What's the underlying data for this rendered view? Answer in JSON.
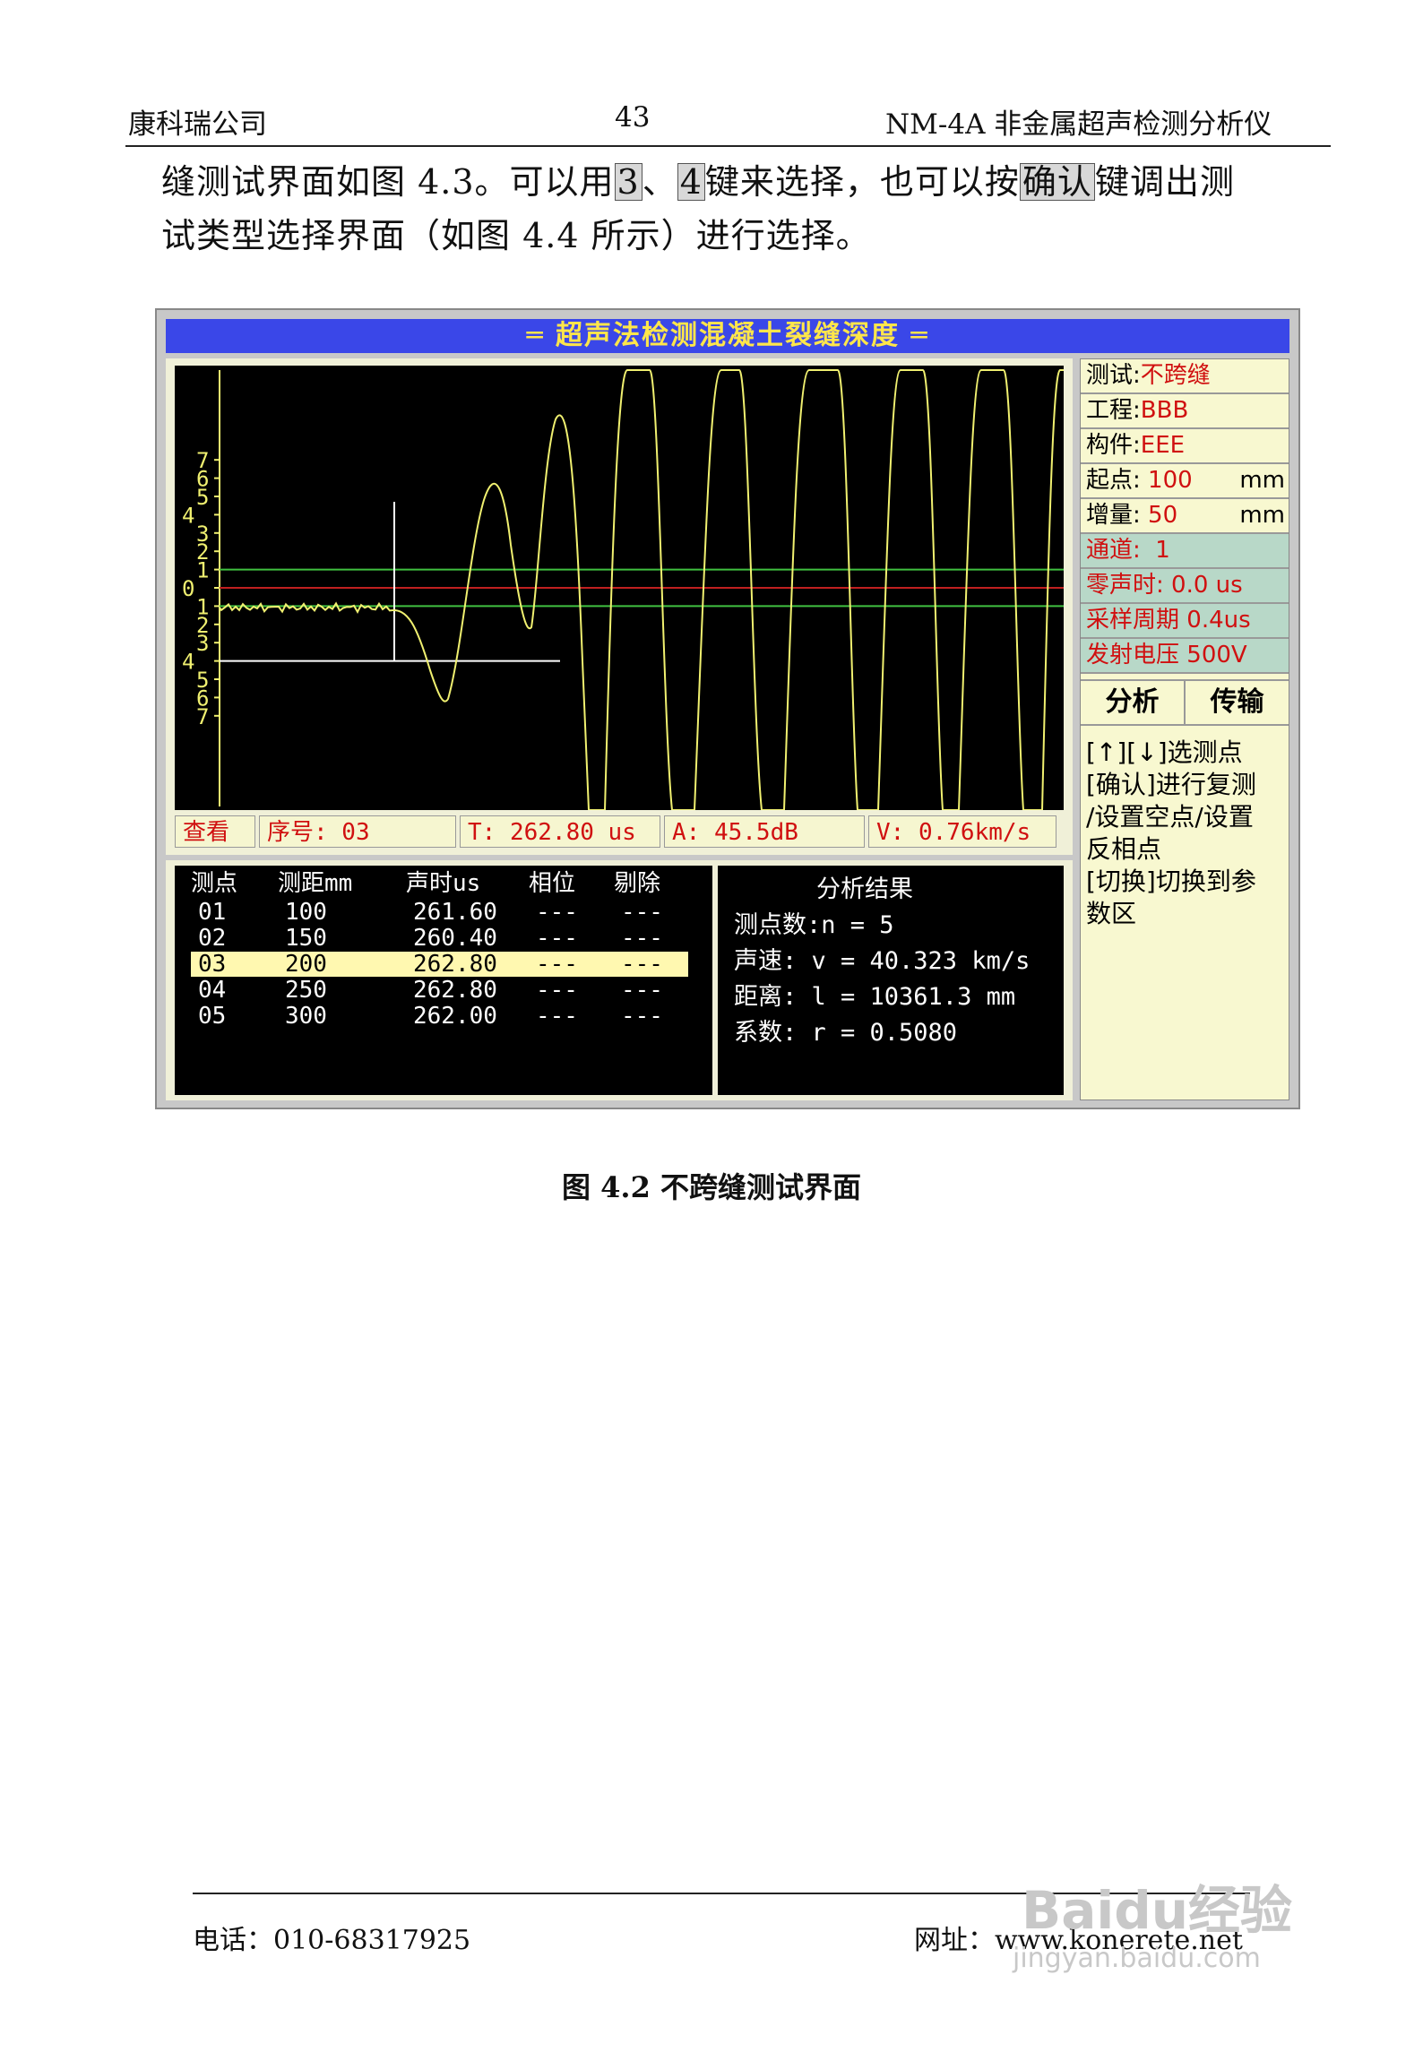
{
  "header": {
    "company": "康科瑞公司",
    "page_number": "43",
    "product": "NM-4A 非金属超声检测分析仪"
  },
  "paragraph": {
    "line1_a": "缝测试界面如图 4.3。可以用",
    "key1": "3",
    "sep": "、",
    "key2": "4",
    "line1_b": "键来选择，也可以按",
    "key3": "确认",
    "line1_c": "键调出测",
    "line2": "试类型选择界面（如图 4.4 所示）进行选择。"
  },
  "screen": {
    "title": "═ 超声法检测混凝土裂缝深度 ═",
    "y_labels_upper": [
      "7",
      "6",
      "5",
      "4",
      "3",
      "2",
      "1",
      "0"
    ],
    "y_labels_lower": [
      "1",
      "2",
      "3",
      "4",
      "5",
      "6",
      "7"
    ],
    "colors": {
      "wave": "#f0f070",
      "zero_line": "#c02020",
      "threshold_line": "#40c040",
      "cursor": "#ffffff"
    },
    "status": {
      "mode": "查看",
      "index": "序号: 03",
      "time": "T: 262.80 us",
      "amp": "A: 45.5dB",
      "vel": "V: 0.76km/s"
    },
    "side": {
      "test_label": "测试:",
      "test_value": "不跨缝",
      "project_label": "工程:",
      "project_value": "BBB",
      "member_label": "构件:",
      "member_value": "EEE",
      "start_label": "起点:",
      "start_value": "100",
      "start_unit": "mm",
      "inc_label": "增量:",
      "inc_value": "50",
      "inc_unit": "mm",
      "channel_label": "通道:",
      "channel_value": "1",
      "zero_label": "零声时:",
      "zero_value": "0.0 us",
      "sample_label": "采样周期",
      "sample_value": "0.4us",
      "volt_label": "发射电压",
      "volt_value": "500V",
      "btn_analyze": "分析",
      "btn_transfer": "传输",
      "help1": "[↑][↓]选测点",
      "help2": "[确认]进行复测",
      "help3": "/设置空点/设置",
      "help4": "反相点",
      "help5": "[切换]切换到参",
      "help6": "数区"
    },
    "table": {
      "headers": [
        "测点",
        "测距mm",
        "声时us",
        "相位",
        "剔除"
      ],
      "rows": [
        [
          "01",
          "100",
          "261.60",
          "---",
          "---"
        ],
        [
          "02",
          "150",
          "260.40",
          "---",
          "---"
        ],
        [
          "03",
          "200",
          "262.80",
          "---",
          "---"
        ],
        [
          "04",
          "250",
          "262.80",
          "---",
          "---"
        ],
        [
          "05",
          "300",
          "262.00",
          "---",
          "---"
        ]
      ],
      "selected_row": 2
    },
    "result": {
      "title": "分析结果",
      "n": "测点数:n = 5",
      "v": "声速:  v = 40.323 km/s",
      "l": "距离:  l = 10361.3 mm",
      "r": "系数:  r = 0.5080"
    }
  },
  "caption": "图 4.2      不跨缝测试界面",
  "footer": {
    "phone": "电话：010-68317925",
    "website": "网址：www.konerete.net"
  },
  "watermark": {
    "brand": "Baidu经验",
    "url": "jingyan.baidu.com"
  }
}
